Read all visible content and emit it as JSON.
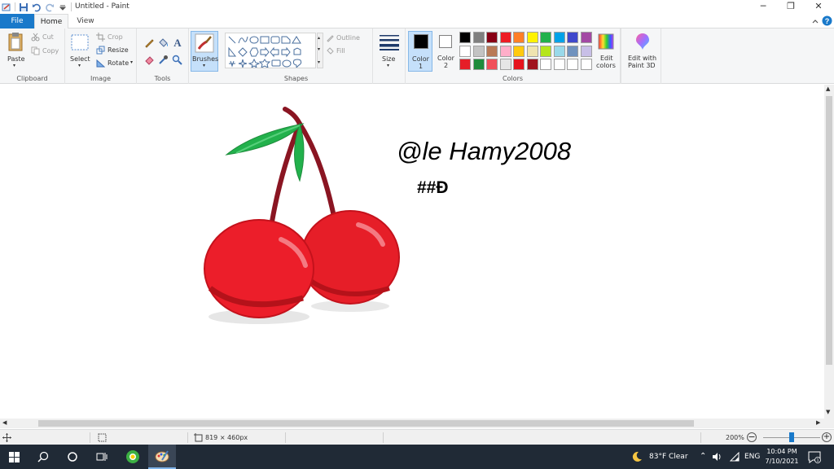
{
  "window": {
    "title": "Untitled - Paint",
    "controls": {
      "minimize": "─",
      "maximize": "❐",
      "close": "✕"
    }
  },
  "tabs": {
    "file": "File",
    "home": "Home",
    "view": "View"
  },
  "clipboard": {
    "paste": "Paste",
    "cut": "Cut",
    "copy": "Copy",
    "group": "Clipboard"
  },
  "image": {
    "select": "Select",
    "crop": "Crop",
    "resize": "Resize",
    "rotate": "Rotate",
    "group": "Image"
  },
  "tools": {
    "group": "Tools",
    "text_glyph": "A"
  },
  "brushes": {
    "label": "Brushes"
  },
  "shapes": {
    "outline": "Outline",
    "fill": "Fill",
    "group": "Shapes"
  },
  "size": {
    "label": "Size"
  },
  "colors": {
    "color1_label": "Color",
    "color1_num": "1",
    "color2_label": "Color",
    "color2_num": "2",
    "color1_value": "#000000",
    "color2_value": "#ffffff",
    "edit_colors_line1": "Edit",
    "edit_colors_line2": "colors",
    "edit3d_line1": "Edit with",
    "edit3d_line2": "Paint 3D",
    "group": "Colors",
    "palette_row1": [
      "#000000",
      "#7f7f7f",
      "#880015",
      "#ed1c24",
      "#ff7f27",
      "#fff200",
      "#22b14c",
      "#00a2e8",
      "#3f48cc",
      "#a349a4"
    ],
    "palette_row2": [
      "#ffffff",
      "#c3c3c3",
      "#b97a57",
      "#ffaec9",
      "#ffc90e",
      "#efe4b0",
      "#b5e61d",
      "#99d9ea",
      "#7092be",
      "#c8bfe7"
    ],
    "palette_row3": [
      "#e61e28",
      "#1e8c3c",
      "#f0505a",
      "#e6e6e6",
      "#e6141e",
      "#a0141e",
      "#ffffff",
      "#ffffff",
      "#ffffff",
      "#ffffff"
    ]
  },
  "canvas": {
    "handwriting_line1": "@le   Hamy2008",
    "handwriting_line2": "##Ð"
  },
  "status": {
    "dimensions": "819 × 460px",
    "zoom": "200%"
  },
  "taskbar": {
    "weather": "83°F  Clear",
    "language": "ENG",
    "time": "10:04 PM",
    "date": "7/10/2021"
  }
}
